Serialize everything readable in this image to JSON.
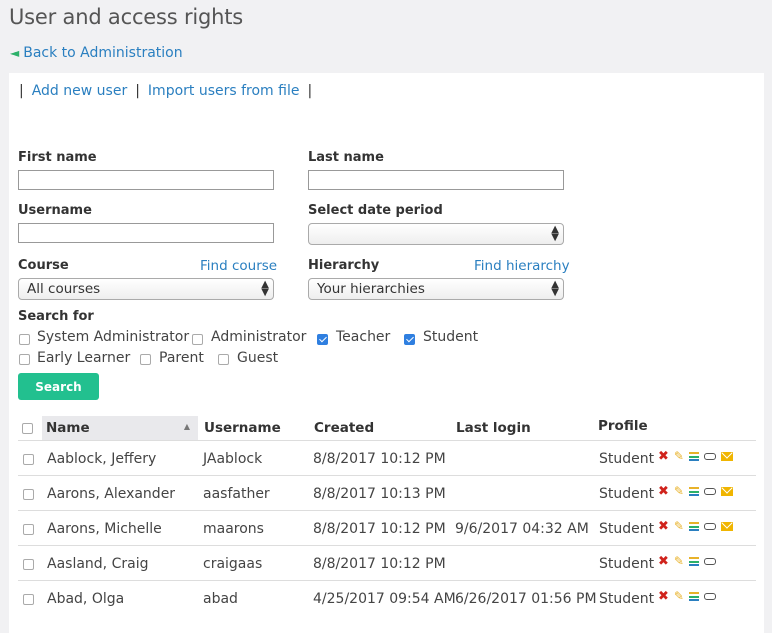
{
  "page": {
    "title": "User and access rights",
    "back_label": "Back to Administration"
  },
  "toolbar": {
    "sep": "|",
    "add_user": "Add new user",
    "import_users": "Import users from file"
  },
  "filters": {
    "first_name_label": "First name",
    "first_name_value": "",
    "last_name_label": "Last name",
    "last_name_value": "",
    "username_label": "Username",
    "username_value": "",
    "date_period_label": "Select date period",
    "date_period_value": "",
    "course_label": "Course",
    "course_link": "Find course",
    "course_value": "All courses",
    "hierarchy_label": "Hierarchy",
    "hierarchy_link": "Find hierarchy",
    "hierarchy_value": "Your hierarchies",
    "search_for_label": "Search for",
    "roles": [
      {
        "label": "System Administrator",
        "checked": false
      },
      {
        "label": "Administrator",
        "checked": false
      },
      {
        "label": "Teacher",
        "checked": true
      },
      {
        "label": "Student",
        "checked": true
      },
      {
        "label": "Early Learner",
        "checked": false
      },
      {
        "label": "Parent",
        "checked": false
      },
      {
        "label": "Guest",
        "checked": false
      }
    ],
    "search_button": "Search"
  },
  "table": {
    "headers": {
      "name": "Name",
      "username": "Username",
      "created": "Created",
      "last_login": "Last login",
      "profile": "Profile"
    },
    "rows": [
      {
        "name": "Aablock, Jeffery",
        "username": "JAablock",
        "created": "8/8/2017 10:12 PM",
        "last_login": "",
        "profile": "Student",
        "mail": true
      },
      {
        "name": "Aarons, Alexander",
        "username": "aasfather",
        "created": "8/8/2017 10:13 PM",
        "last_login": "",
        "profile": "Student",
        "mail": true
      },
      {
        "name": "Aarons, Michelle",
        "username": "maarons",
        "created": "8/8/2017 10:12 PM",
        "last_login": "9/6/2017 04:32 AM",
        "profile": "Student",
        "mail": true
      },
      {
        "name": "Aasland, Craig",
        "username": "craigaas",
        "created": "8/8/2017 10:12 PM",
        "last_login": "",
        "profile": "Student",
        "mail": false
      },
      {
        "name": "Abad, Olga",
        "username": "abad",
        "created": "4/25/2017 09:54 AM",
        "last_login": "6/26/2017 01:56 PM",
        "profile": "Student",
        "mail": false
      }
    ]
  },
  "colors": {
    "link": "#2a7fc0",
    "accent_button": "#22c08f",
    "checkbox_checked": "#2f7fe0",
    "delete_icon": "#d0231c"
  }
}
